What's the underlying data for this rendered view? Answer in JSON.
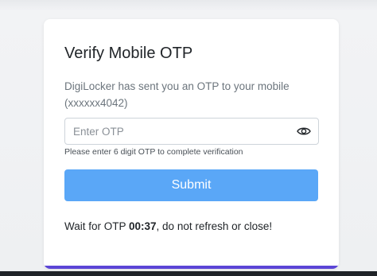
{
  "card": {
    "title": "Verify Mobile OTP",
    "description": "DigiLocker has sent you an OTP to your mobile (xxxxxx4042)",
    "otp_placeholder": "Enter OTP",
    "otp_value": "",
    "toggle_icon": "eye-icon",
    "hint": "Please enter 6 digit OTP to complete verification",
    "submit_label": "Submit",
    "wait_prefix": "Wait for OTP ",
    "wait_timer": "00:37",
    "wait_suffix": ", do not refresh or close!"
  },
  "colors": {
    "submit_bg": "#5aa7f7",
    "accent": "#5b45d6",
    "page_bg": "#eef0f2"
  }
}
